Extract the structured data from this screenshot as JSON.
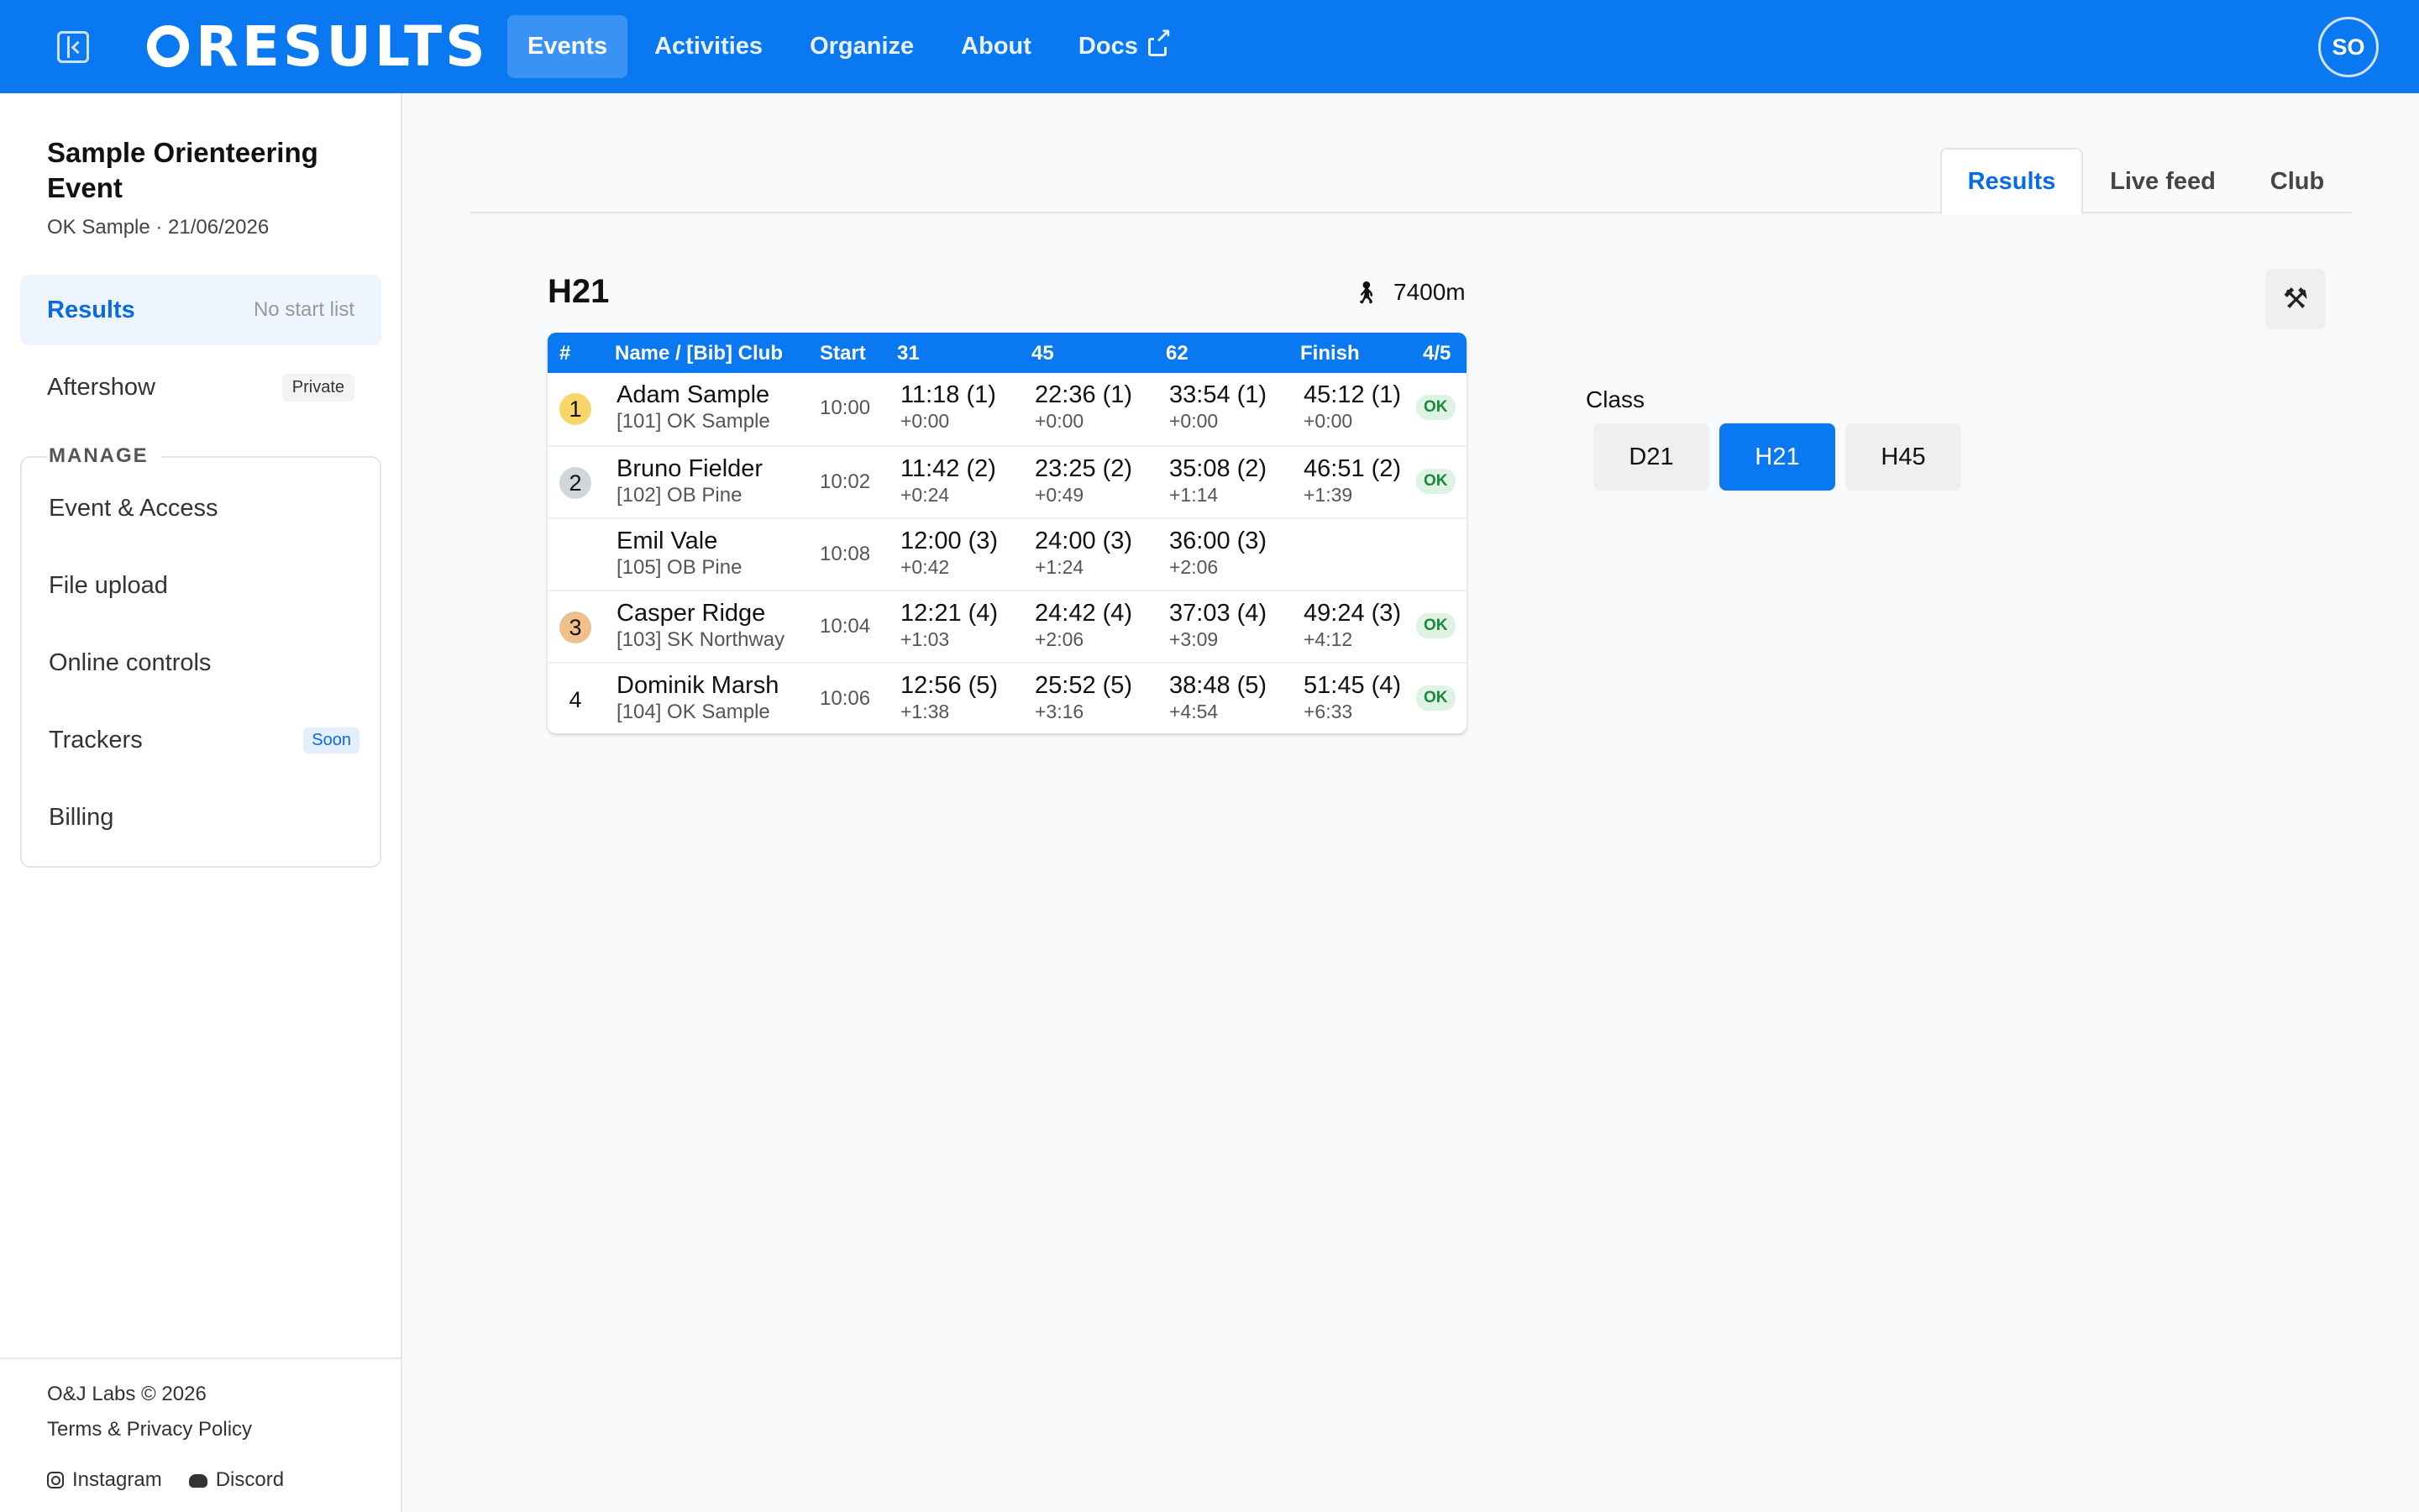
{
  "topbar": {
    "logo_text": "RESULTS",
    "nav": [
      {
        "label": "Events",
        "active": true
      },
      {
        "label": "Activities"
      },
      {
        "label": "Organize"
      },
      {
        "label": "About"
      },
      {
        "label": "Docs",
        "external": true
      }
    ],
    "avatar": "SO",
    "accent": "#0a78f0"
  },
  "sidebar": {
    "event_title": "Sample Orienteering Event",
    "event_sub": "OK Sample · 21/06/2026",
    "items": [
      {
        "label": "Results",
        "note": "No start list",
        "active": true
      },
      {
        "label": "Aftershow",
        "badge": "Private"
      }
    ],
    "manage_label": "MANAGE",
    "manage_items": [
      {
        "label": "Event & Access"
      },
      {
        "label": "File upload"
      },
      {
        "label": "Online controls"
      },
      {
        "label": "Trackers",
        "badge": "Soon"
      },
      {
        "label": "Billing"
      }
    ],
    "footer": {
      "copyright": "O&J Labs © 2026",
      "terms": "Terms & Privacy Policy",
      "instagram": "Instagram",
      "discord": "Discord"
    }
  },
  "tabs": [
    {
      "label": "Results",
      "active": true
    },
    {
      "label": "Live feed"
    },
    {
      "label": "Club"
    }
  ],
  "class_view": {
    "title": "H21",
    "length": "7400m",
    "tools_icon": "tools-icon"
  },
  "results_table": {
    "headers": [
      "#",
      "Name / [Bib] Club",
      "Start",
      "31",
      "45",
      "62",
      "Finish",
      "4/5"
    ],
    "rows": [
      {
        "place": "1",
        "place_color": "#f9d56a",
        "name": "Adam Sample",
        "club": "[101] OK Sample",
        "start": "10:00",
        "splits": [
          {
            "t": "11:18 (1)",
            "d": "+0:00"
          },
          {
            "t": "22:36 (1)",
            "d": "+0:00"
          },
          {
            "t": "33:54 (1)",
            "d": "+0:00"
          },
          {
            "t": "45:12 (1)",
            "d": "+0:00"
          }
        ],
        "status": "OK"
      },
      {
        "place": "2",
        "place_color": "#cfd6dc",
        "name": "Bruno Fielder",
        "club": "[102] OB Pine",
        "start": "10:02",
        "splits": [
          {
            "t": "11:42 (2)",
            "d": "+0:24"
          },
          {
            "t": "23:25 (2)",
            "d": "+0:49"
          },
          {
            "t": "35:08 (2)",
            "d": "+1:14"
          },
          {
            "t": "46:51 (2)",
            "d": "+1:39"
          }
        ],
        "status": "OK"
      },
      {
        "place": "",
        "place_color": "",
        "name": "Emil Vale",
        "club": "[105] OB Pine",
        "start": "10:08",
        "splits": [
          {
            "t": "12:00 (3)",
            "d": "+0:42"
          },
          {
            "t": "24:00 (3)",
            "d": "+1:24"
          },
          {
            "t": "36:00 (3)",
            "d": "+2:06"
          },
          {
            "t": "",
            "d": ""
          }
        ],
        "status": ""
      },
      {
        "place": "3",
        "place_color": "#f0c08a",
        "name": "Casper Ridge",
        "club": "[103] SK Northway",
        "start": "10:04",
        "splits": [
          {
            "t": "12:21 (4)",
            "d": "+1:03"
          },
          {
            "t": "24:42 (4)",
            "d": "+2:06"
          },
          {
            "t": "37:03 (4)",
            "d": "+3:09"
          },
          {
            "t": "49:24 (3)",
            "d": "+4:12"
          }
        ],
        "status": "OK"
      },
      {
        "place": "4",
        "place_color": "",
        "name": "Dominik Marsh",
        "club": "[104] OK Sample",
        "start": "10:06",
        "splits": [
          {
            "t": "12:56 (5)",
            "d": "+1:38"
          },
          {
            "t": "25:52 (5)",
            "d": "+3:16"
          },
          {
            "t": "38:48 (5)",
            "d": "+4:54"
          },
          {
            "t": "51:45 (4)",
            "d": "+6:33"
          }
        ],
        "status": "OK"
      }
    ]
  },
  "class_selector": {
    "label": "Class",
    "options": [
      {
        "label": "D21"
      },
      {
        "label": "H21",
        "active": true
      },
      {
        "label": "H45"
      }
    ]
  }
}
